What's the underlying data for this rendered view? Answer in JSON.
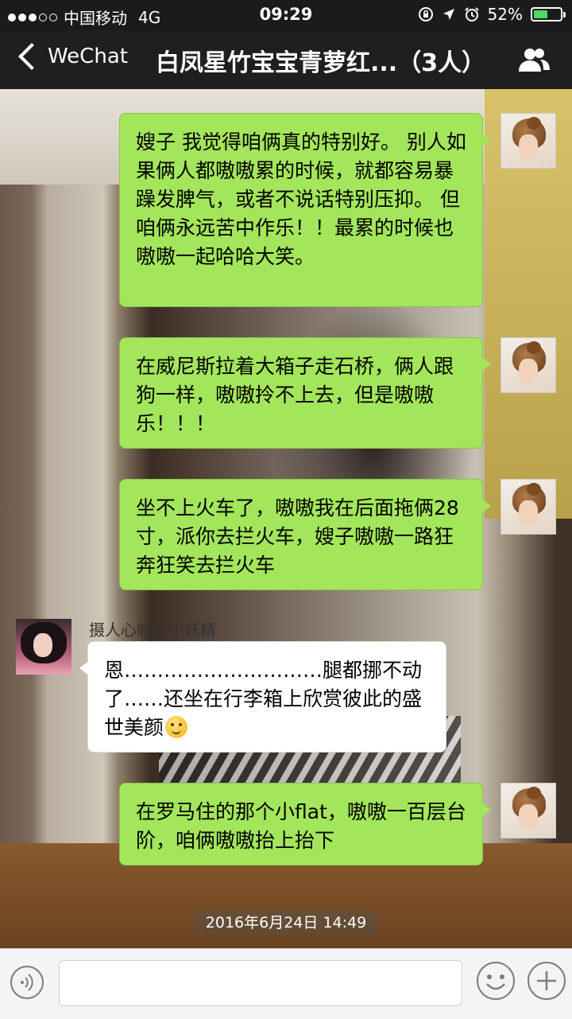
{
  "status_bar": {
    "carrier": "中国移动",
    "network": "4G",
    "time": "09:29",
    "battery_percent": "52%",
    "battery_level": 0.52
  },
  "nav": {
    "back_label": "WeChat",
    "title": "白凤星竹宝宝青萝红...（3人）"
  },
  "messages": [
    {
      "side": "out",
      "text": "嫂子 我觉得咱俩真的特别好。 别人如果俩人都嗷嗷累的时候，就都容易暴躁发脾气，或者不说话特别压抑。 但咱俩永远苦中作乐！！最累的时候也嗷嗷一起哈哈大笑。"
    },
    {
      "side": "out",
      "text": "在威尼斯拉着大箱子走石桥，俩人跟狗一样，嗷嗷拎不上去，但是嗷嗷乐！！！"
    },
    {
      "side": "out",
      "text": "坐不上火车了，嗷嗷我在后面拖俩28寸，派你去拦火车，嫂子嗷嗷一路狂奔狂笑去拦火车"
    },
    {
      "side": "in",
      "sender": "摄人心魄的小妖精",
      "text": "恩…………………………腿都挪不动了……还坐在行李箱上欣赏彼此的盛世美颜",
      "emoji": "smiling-face-emoji"
    },
    {
      "side": "out",
      "text": "在罗马住的那个小flat，嗷嗷一百层台阶，咱俩嗷嗷抬上抬下"
    }
  ],
  "timestamp": "2016年6月24日 14:49",
  "input_bar": {
    "placeholder": ""
  },
  "colors": {
    "outgoing_bubble": "#a3e55b",
    "incoming_bubble": "#ffffff",
    "nav_background": "#1f1f21",
    "battery_fill": "#4cd964"
  },
  "icons": [
    "voice-icon",
    "emoji-icon",
    "plus-icon",
    "contacts-icon",
    "back-chevron-icon",
    "lock-rotation-icon",
    "location-arrow-icon",
    "alarm-icon"
  ]
}
